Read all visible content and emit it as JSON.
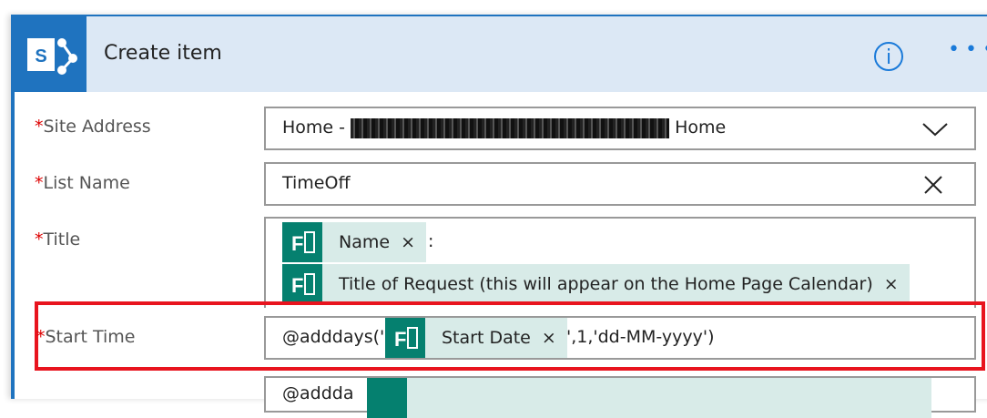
{
  "header": {
    "title": "Create item",
    "info_icon": "info-icon",
    "more_icon": "more-icon"
  },
  "fields": {
    "site_address": {
      "label": "Site Address",
      "required": "*",
      "value_prefix": "Home - ",
      "value_suffix": " Home"
    },
    "list_name": {
      "label": "List Name",
      "required": "*",
      "value": "TimeOff"
    },
    "title": {
      "label": "Title",
      "required": "*",
      "chip1": "Name",
      "separator": ":",
      "chip2": "Title of Request (this will appear on the Home Page Calendar)"
    },
    "start_time": {
      "label": "Start Time",
      "required": "*",
      "prefix": "@adddays('",
      "chip": "Start Date",
      "suffix": "',1,'dd-MM-yyyy')"
    },
    "next": {
      "prefix": "@addda"
    }
  },
  "chip_remove": "×",
  "colors": {
    "brand": "#1f73bf",
    "forms": "#05806f",
    "highlight": "#e8141e"
  }
}
